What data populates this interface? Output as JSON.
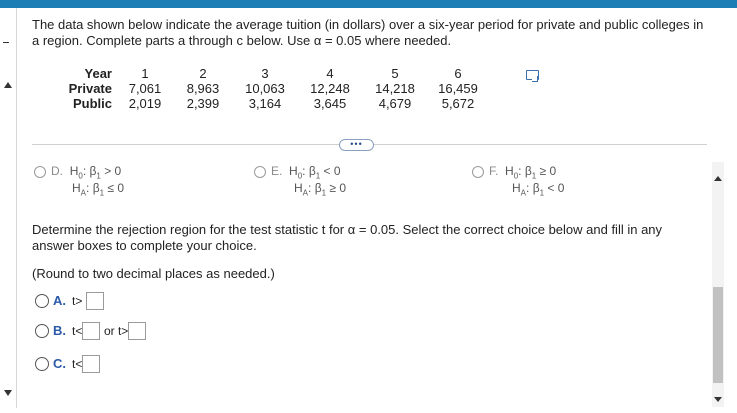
{
  "problem": {
    "intro": "The data shown below indicate the average tuition (in dollars) over a six-year period for private and public colleges in a region. Complete parts a through c below. Use α = 0.05 where needed."
  },
  "table": {
    "row_labels": [
      "Year",
      "Private",
      "Public"
    ],
    "years": [
      "1",
      "2",
      "3",
      "4",
      "5",
      "6"
    ],
    "private": [
      "7,061",
      "8,963",
      "10,063",
      "12,248",
      "14,218",
      "16,459"
    ],
    "public": [
      "2,019",
      "2,399",
      "3,164",
      "3,645",
      "4,679",
      "5,672"
    ]
  },
  "more_button": "•••",
  "hypothesis_options": [
    {
      "letter": "D.",
      "h0": "β",
      "h0_rel": " > 0",
      "ha": "β",
      "ha_rel": " ≤ 0"
    },
    {
      "letter": "E.",
      "h0": "β",
      "h0_rel": " < 0",
      "ha": "β",
      "ha_rel": " ≥ 0"
    },
    {
      "letter": "F.",
      "h0": "β",
      "h0_rel": " ≥ 0",
      "ha": "β",
      "ha_rel": " < 0"
    }
  ],
  "h_labels": {
    "h": "H",
    "h0_sub": "0",
    "ha_sub": "A",
    "beta_sub": "1",
    "colon": ":"
  },
  "question": "Determine the rejection region for the test statistic t for α = 0.05. Select the correct choice below and fill in any answer boxes to complete your choice.",
  "round_note": "(Round to two decimal places as needed.)",
  "choices": [
    {
      "letter": "A.",
      "pre": "t>",
      "mid": "",
      "post": ""
    },
    {
      "letter": "B.",
      "pre": "t<",
      "mid": "or t>",
      "post": ""
    },
    {
      "letter": "C.",
      "pre": "t<",
      "mid": "",
      "post": ""
    }
  ]
}
